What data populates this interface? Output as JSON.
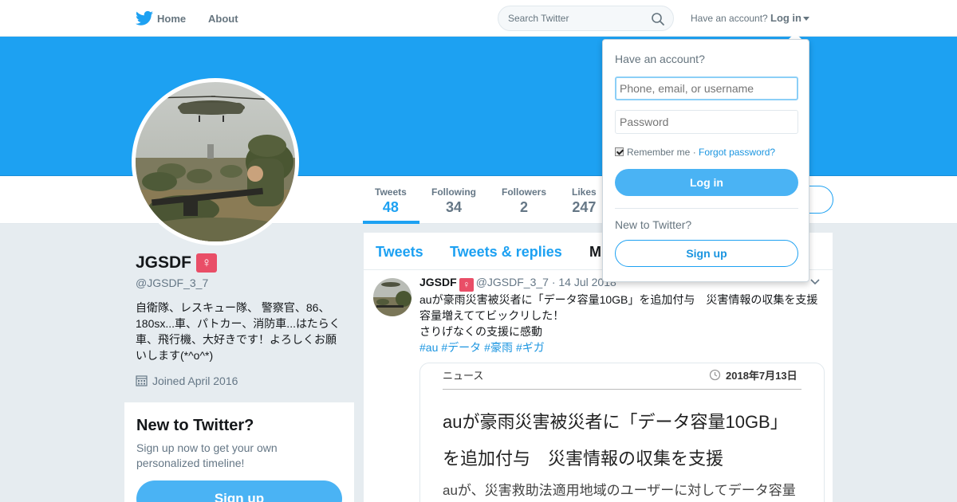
{
  "nav": {
    "home": "Home",
    "about": "About",
    "search_placeholder": "Search Twitter",
    "have_account": "Have an account?",
    "login": "Log in"
  },
  "profile": {
    "name": "JGSDF",
    "gender_emoji": "♀",
    "handle": "@JGSDF_3_7",
    "bio": "自衛隊、レスキュー隊、 警察官、86、180sx...車、パトカー、消防車...はたらく車、飛行機、大好きです！よろしくお願いします(*^o^*)",
    "joined": "Joined April 2016"
  },
  "stats": [
    {
      "label": "Tweets",
      "value": "48"
    },
    {
      "label": "Following",
      "value": "34"
    },
    {
      "label": "Followers",
      "value": "2"
    },
    {
      "label": "Likes",
      "value": "247"
    }
  ],
  "new_to_twitter": {
    "title": "New to Twitter?",
    "description": "Sign up now to get your own personalized timeline!",
    "signup": "Sign up"
  },
  "timeline": {
    "tabs": [
      "Tweets",
      "Tweets & replies",
      "M"
    ],
    "tweet": {
      "name": "JGSDF",
      "badge": "♀",
      "handle": "@JGSDF_3_7",
      "separator": "·",
      "date": "14 Jul 2018",
      "line1": "auが豪雨災害被災者に「データ容量10GB」を追加付与　災害情報の収集を支援",
      "line2": "容量増えててビックリした！",
      "line3": "さりげなくの支援に感動",
      "hashtags": [
        "#au",
        "#データ",
        "#豪雨",
        "#ギガ"
      ],
      "media": {
        "category": "ニュース",
        "date": "2018年7月13日",
        "headline1": "auが豪雨災害被災者に「データ容量10GB」",
        "headline2": "を追加付与　災害情報の収集を支援",
        "subtext": "auが、災害救助法適用地域のユーザーに対してデータ容量"
      }
    }
  },
  "login_dropdown": {
    "title": "Have an account?",
    "username_placeholder": "Phone, email, or username",
    "password_placeholder": "Password",
    "remember_me": "Remember me",
    "separator": "·",
    "forgot_password": "Forgot password?",
    "login_button": "Log in",
    "new_to_twitter": "New to Twitter?",
    "signup_button": "Sign up"
  },
  "colors": {
    "brand_blue": "#1da1f2",
    "button_blue": "#4ab3f4",
    "page_bg": "#e6ecf0",
    "gender_badge": "#e94e67"
  }
}
